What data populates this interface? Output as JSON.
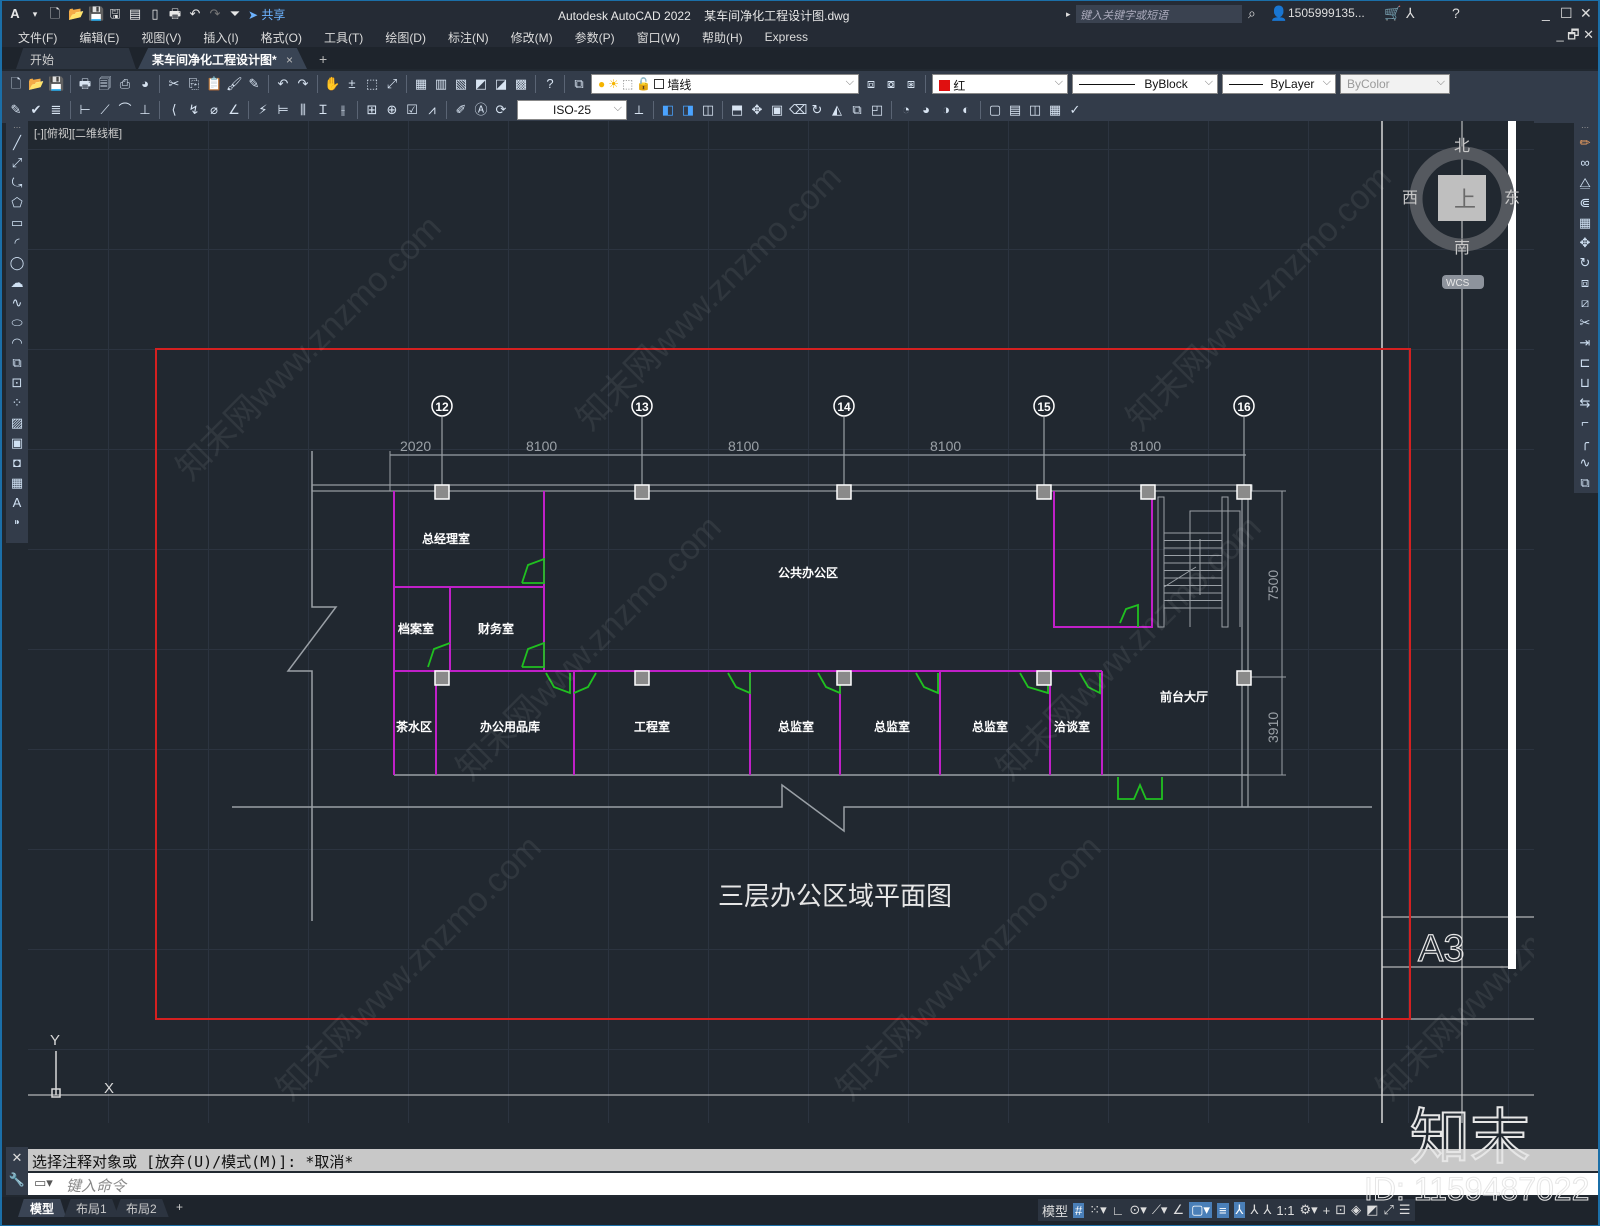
{
  "titlebar": {
    "app_title": "Autodesk AutoCAD 2022",
    "file_name": "某车间净化工程设计图.dwg",
    "share_label": "共享",
    "search_placeholder": "键入关键字或短语",
    "user": "1505999135...",
    "icons": [
      "autocad-logo-icon",
      "new-icon",
      "open-icon",
      "save-icon",
      "save-as-icon",
      "publish-icon",
      "mobile-icon",
      "print-icon",
      "undo-icon",
      "redo-icon",
      "customize-icon",
      "share-icon"
    ]
  },
  "menu": [
    "文件(F)",
    "编辑(E)",
    "视图(V)",
    "插入(I)",
    "格式(O)",
    "工具(T)",
    "绘图(D)",
    "标注(N)",
    "修改(M)",
    "参数(P)",
    "窗口(W)",
    "帮助(H)",
    "Express"
  ],
  "tabs": [
    {
      "label": "开始",
      "active": false
    },
    {
      "label": "某车间净化工程设计图*",
      "active": true,
      "close": "×"
    }
  ],
  "tab_add": "+",
  "toolbar": {
    "layer_value": "墙线",
    "color_value": "红",
    "color_swatch": "#e01010",
    "linetype_value": "ByBlock",
    "lineweight_value": "ByLayer",
    "plotstyle_value": "ByColor",
    "dimstyle_value": "ISO-25"
  },
  "viewport": {
    "view_label": "[-][俯视][二维线框]",
    "viewcube": {
      "north": "北",
      "south": "南",
      "east": "东",
      "west": "西",
      "face": "上",
      "wcs": "WCS"
    },
    "ucs": {
      "x": "X",
      "y": "Y"
    }
  },
  "drawing": {
    "title": "三层办公区域平面图",
    "sheet_label": "A3",
    "axes": [
      "12",
      "13",
      "14",
      "15",
      "16"
    ],
    "dims_top": [
      "2020",
      "8100",
      "8100",
      "8100",
      "8100"
    ],
    "dims_right": [
      "7500",
      "3910"
    ],
    "rooms": [
      "总经理室",
      "档案室",
      "财务室",
      "公共办公区",
      "茶水区",
      "办公用品库",
      "工程室",
      "总监室",
      "总监室",
      "总监室",
      "洽谈室",
      "前台大厅"
    ],
    "colors": {
      "border": "#d42020",
      "partition": "#c020c8",
      "door": "#20c020",
      "wall": "#9aa0a6"
    }
  },
  "command": {
    "history": "选择注释对象或 [放弃(U)/模式(M)]: *取消*",
    "placeholder": "键入命令"
  },
  "layout_tabs": [
    "模型",
    "布局1",
    "布局2",
    "+"
  ],
  "status": {
    "model": "模型",
    "scale": "1:1"
  },
  "watermark": {
    "brand": "知末",
    "id": "ID: 1159487022",
    "site": "知末网www.znzmo.com"
  }
}
